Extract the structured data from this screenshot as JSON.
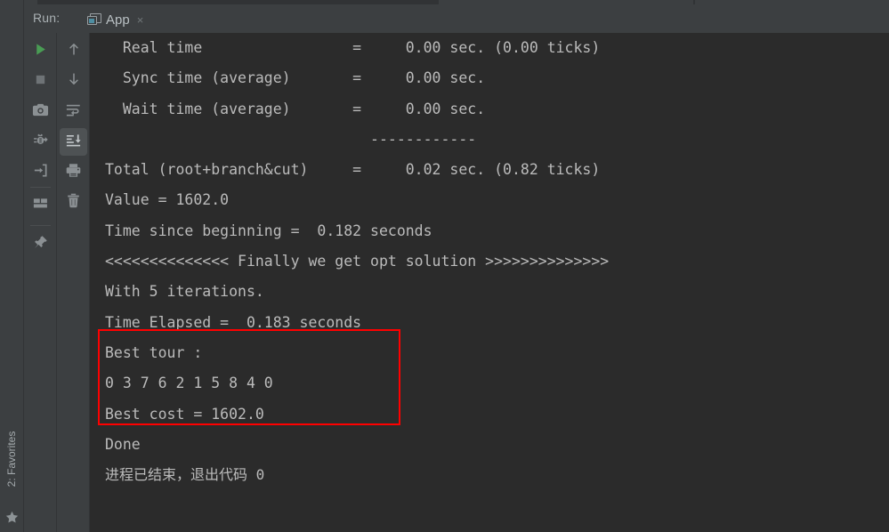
{
  "window": {
    "run_label": "Run:",
    "tab": {
      "title": "App",
      "close_glyph": "×",
      "icon": "run-configuration-icon"
    }
  },
  "left_stripe": {
    "favorites_label": "2: Favorites",
    "star_icon": "star-icon"
  },
  "toolbar_primary": {
    "buttons": [
      {
        "name": "rerun-button",
        "icon": "play-icon",
        "label": "Rerun"
      },
      {
        "name": "stop-button",
        "icon": "stop-square-icon",
        "label": "Stop"
      },
      {
        "name": "screenshot-button",
        "icon": "camera-icon",
        "label": "Screenshot"
      },
      {
        "name": "debug-attach-button",
        "icon": "bug-arrow-icon",
        "label": "Attach debugger"
      },
      {
        "name": "import-button",
        "icon": "arrow-into-box-icon",
        "label": "Import"
      },
      {
        "name": "layout-button",
        "icon": "panels-icon",
        "label": "Layout"
      },
      {
        "name": "pin-tab-button",
        "icon": "pin-icon",
        "label": "Pin tab"
      }
    ]
  },
  "toolbar_secondary": {
    "buttons": [
      {
        "name": "up-the-stack-button",
        "icon": "arrow-up-icon",
        "label": "Up the stack trace"
      },
      {
        "name": "down-the-stack-button",
        "icon": "arrow-down-icon",
        "label": "Down the stack trace"
      },
      {
        "name": "soft-wrap-button",
        "icon": "soft-wrap-icon",
        "label": "Soft-wrap",
        "selected": false
      },
      {
        "name": "scroll-to-end-button",
        "icon": "scroll-to-end-icon",
        "label": "Scroll to the end",
        "selected": true
      },
      {
        "name": "print-button",
        "icon": "printer-icon",
        "label": "Print"
      },
      {
        "name": "clear-all-button",
        "icon": "trash-icon",
        "label": "Clear all"
      }
    ]
  },
  "console": {
    "lines": [
      "  Real time                 =     0.00 sec. (0.00 ticks)",
      "  Sync time (average)       =     0.00 sec.",
      "  Wait time (average)       =     0.00 sec.",
      "                              ------------",
      "Total (root+branch&cut)     =     0.02 sec. (0.82 ticks)",
      "Value = 1602.0",
      "Time since beginning =  0.182 seconds",
      "<<<<<<<<<<<<<< Finally we get opt solution >>>>>>>>>>>>>>",
      "With 5 iterations.",
      "Time Elapsed =  0.183 seconds",
      "Best tour :",
      "0 3 7 6 2 1 5 8 4 0",
      "Best cost = 1602.0",
      "Done",
      "",
      "进程已结束，退出代码 0"
    ],
    "cjk_line_indexes": [
      15
    ],
    "highlight": {
      "name": "best-result-annotation-box",
      "color": "#ff0000",
      "covers_lines": [
        "Best tour :",
        "0 3 7 6 2 1 5 8 4 0",
        "Best cost = 1602.0"
      ]
    }
  },
  "colors": {
    "chrome_bg": "#3c3f41",
    "console_bg": "#2b2b2b",
    "console_text": "#bbbbbb",
    "accent_green": "#499c54",
    "annotation_red": "#ff0000",
    "tab_icon_teal": "#4e8ea2"
  }
}
